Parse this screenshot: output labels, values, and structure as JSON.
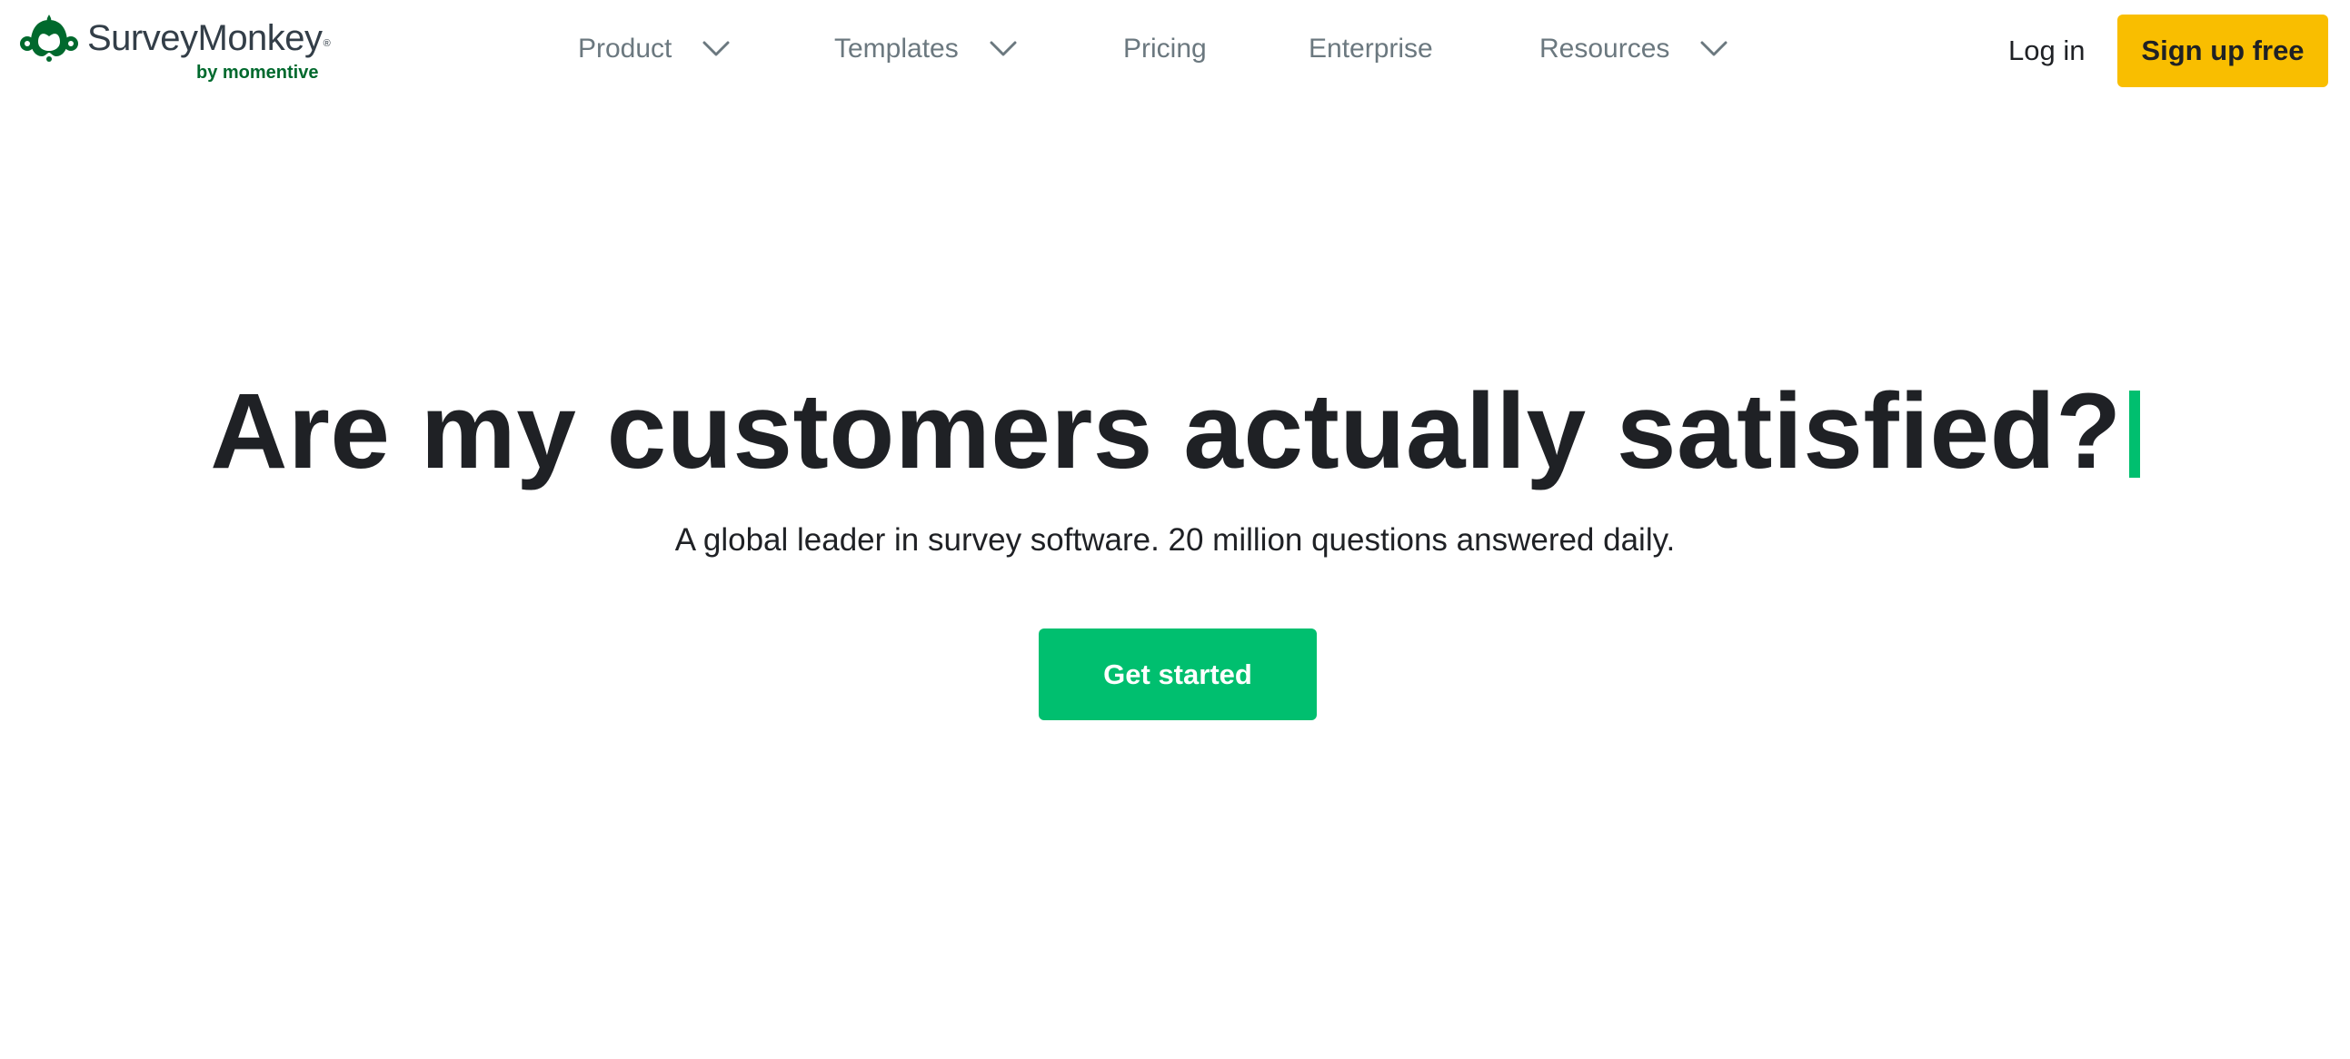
{
  "brand": {
    "name": "SurveyMonkey",
    "registered_mark": "®",
    "tagline": "by momentive",
    "color": "#00692d"
  },
  "nav": {
    "items": [
      {
        "label": "Product",
        "has_dropdown": true,
        "icon": "chevron-down-icon"
      },
      {
        "label": "Templates",
        "has_dropdown": true,
        "icon": "chevron-down-icon"
      },
      {
        "label": "Pricing",
        "has_dropdown": false
      },
      {
        "label": "Enterprise",
        "has_dropdown": false
      },
      {
        "label": "Resources",
        "has_dropdown": true,
        "icon": "chevron-down-icon"
      }
    ],
    "login_label": "Log in",
    "signup_label": "Sign up free",
    "signup_color": "#f9be00"
  },
  "hero": {
    "title": "Are my customers actually satisfied?",
    "cursor_color": "#00bf6f",
    "subtitle": "A global leader in survey software. 20 million questions answered daily.",
    "cta_label": "Get started",
    "cta_color": "#00bf6f"
  }
}
